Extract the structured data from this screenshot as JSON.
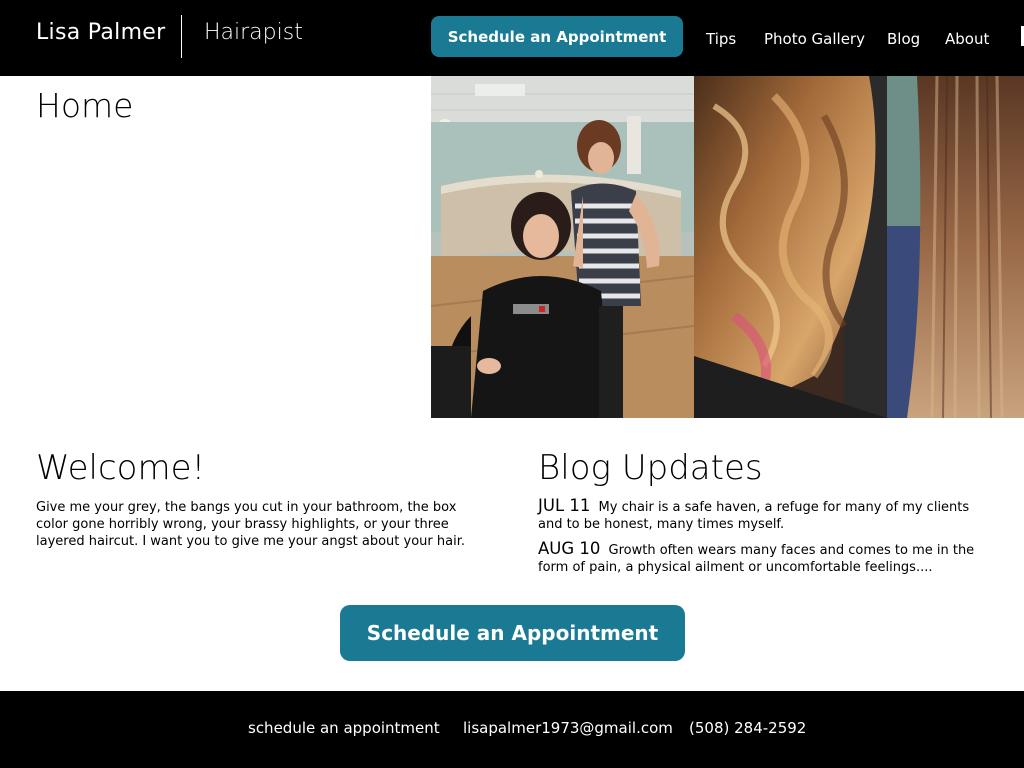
{
  "header": {
    "brand_name": "Lisa Palmer",
    "tagline": "Hairapist",
    "cta_label": "Schedule an Appointment",
    "nav": [
      "Tips",
      "Photo Gallery",
      "Blog",
      "About"
    ]
  },
  "page_title": "Home",
  "welcome": {
    "title": "Welcome!",
    "text": "Give me your grey, the bangs you cut in your bathroom, the box color gone horribly wrong, your brassy highlights, or your three layered haircut. I want you to give me your angst about your hair."
  },
  "blog": {
    "title": "Blog Updates",
    "items": [
      {
        "date": "JUL 11",
        "text": "My chair is a safe haven, a refuge for many of my clients and to be honest, many times myself."
      },
      {
        "date": "AUG 10",
        "text": "Growth often wears many faces and comes to me in the form of pain, a physical ailment or uncomfortable feelings...."
      }
    ]
  },
  "main_cta_label": "Schedule an Appointment",
  "footer": {
    "links": [
      "schedule an appointment",
      "lisapalmer1973@gmail.com",
      "(508) 284-2592"
    ]
  },
  "colors": {
    "accent": "#1a7a93",
    "header_bg": "#000000",
    "footer_bg": "#000000"
  }
}
